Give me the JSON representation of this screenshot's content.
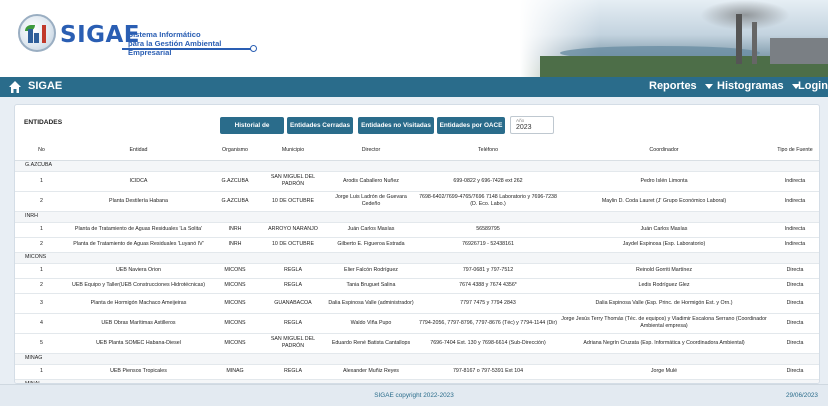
{
  "header": {
    "logo_word": "SIGAE",
    "logo_subtitle_1": "Sistema Informático",
    "logo_subtitle_2": "para la Gestión Ambiental Empresarial"
  },
  "nav": {
    "brand": "SIGAE",
    "reportes": "Reportes",
    "histogramas": "Histogramas",
    "login": "Login"
  },
  "page": {
    "title": "ENTIDADES",
    "buttons": {
      "historial": "Historial de Entidades",
      "cerradas": "Entidades Cerradas",
      "no_visitadas": "Entidades no Visitadas",
      "por_oace": "Entidades por OACE"
    },
    "year": {
      "label": "Año",
      "value": "2023"
    }
  },
  "table": {
    "headers": {
      "no": "No",
      "entidad": "Entidad",
      "organismo": "Organismo",
      "municipio": "Municipio",
      "director": "Director",
      "telefono": "Teléfono",
      "coordinador": "Coordinador",
      "tipo": "Tipo de Fuente"
    },
    "groups": [
      {
        "name": "G.AZCUBA",
        "rows": [
          {
            "no": "1",
            "entidad": "ICIDCA",
            "organismo": "G.AZCUBA",
            "municipio": "SAN MIGUEL DEL PADRÓN",
            "director": "Arodis Caballero Nuñez",
            "telefono": "699-0822 y 696-7428 ext 262",
            "coordinador": "Pedro Islén Limonta",
            "tipo": "Indirecta"
          },
          {
            "no": "2",
            "entidad": "Planta Destilería Habana",
            "organismo": "G.AZCUBA",
            "municipio": "10 DE OCTUBRE",
            "director": "Jorge Luis Ladrón de Guevara Cedeño",
            "telefono": "7698-6402/7699-4765/7696 7148 Laboratorio y 7696-7238 (D. Eco. Labo.)",
            "coordinador": "Maylin D. Coda Lauret (J' Grupo Económico Laboral)",
            "tipo": "Indirecta"
          }
        ]
      },
      {
        "name": "INRH",
        "rows": [
          {
            "no": "1",
            "entidad": "Planta de Tratamiento de Aguas Residuales 'La Solita'",
            "organismo": "INRH",
            "municipio": "ARROYO NARANJO",
            "director": "Juán Carlos Masías",
            "telefono": "56589795",
            "coordinador": "Juán Carlos Masías",
            "tipo": "Indirecta"
          },
          {
            "no": "2",
            "entidad": "Planta de Tratamiento de Aguas Residuales 'Luyanó IV'",
            "organismo": "INRH",
            "municipio": "10 DE OCTUBRE",
            "director": "Gilberto E. Figueroa Estrada",
            "telefono": "76926719 - 52438161",
            "coordinador": "Jaydel Espinosa (Esp. Laboratorio)",
            "tipo": "Indirecta"
          }
        ]
      },
      {
        "name": "MICONS",
        "rows": [
          {
            "no": "1",
            "entidad": "UEB Naviera Orion",
            "organismo": "MICONS",
            "municipio": "REGLA",
            "director": "Elier Falcón Rodríguez",
            "telefono": "797-0681 y 797-7512",
            "coordinador": "Reinold Gorriti Martínez",
            "tipo": "Directa"
          },
          {
            "no": "2",
            "entidad": "UEB Equipo y Taller(UEB Construcciones Hidrotécnicas)",
            "organismo": "MICONS",
            "municipio": "REGLA",
            "director": "Tania Bruguet Salina",
            "telefono": "7674 4388 y 7674 4356*",
            "coordinador": "Ledis Rodríguez Glez",
            "tipo": "Directa"
          },
          {
            "no": "3",
            "entidad": "Planta de Hormigón Machaco Ameijeiras",
            "organismo": "MICONS",
            "municipio": "GUANABACOA",
            "director": "Dalia Espinosa Valle (administrador)",
            "telefono": "7797 7475 y 7794 2843",
            "coordinador": "Dalia Espinosa Valle (Esp. Princ. de Hormigón Est. y Orn.)",
            "tipo": "Directa"
          },
          {
            "no": "4",
            "entidad": "UEB Obras Marítimas Astilleros",
            "organismo": "MICONS",
            "municipio": "REGLA",
            "director": "Waldo Viña Pupo",
            "telefono": "7794-2056, 7797-8796, 7797-8676 (Téc) y 7794-1144 (Dir)",
            "coordinador": "Jorge Jesús Terry Thomás (Téc. de equipos) y Vladimir Escalona Serrano (Coordinador Ambiental empresa)",
            "tipo": "Directa"
          },
          {
            "no": "5",
            "entidad": "UEB Planta SOMEC Habana-Diesel",
            "organismo": "MICONS",
            "municipio": "SAN MIGUEL DEL PADRÓN",
            "director": "Eduardo René Batista Cantallops",
            "telefono": "7696-7404 Ext. 130 y 7698-6614 (Sub-Dirección)",
            "coordinador": "Adriana Negrín Cruzata (Esp. Informática y Coordinadora Ambiental)",
            "tipo": "Directa"
          }
        ]
      },
      {
        "name": "MINAG",
        "rows": [
          {
            "no": "1",
            "entidad": "UEB Piensos Tropicales",
            "organismo": "MINAG",
            "municipio": "REGLA",
            "director": "Alexander Muñiz Reyes",
            "telefono": "797-8167 o 797-5391 Ext 104",
            "coordinador": "Jorge Mulé",
            "tipo": "Directa"
          }
        ]
      },
      {
        "name": "MINAL",
        "rows": []
      }
    ]
  },
  "footer": {
    "copyright": "SIGAE copyright 2022-2023",
    "date": "29/06/2023"
  },
  "colors": {
    "primary": "#2a6c8b",
    "brand": "#2a5eb3"
  }
}
